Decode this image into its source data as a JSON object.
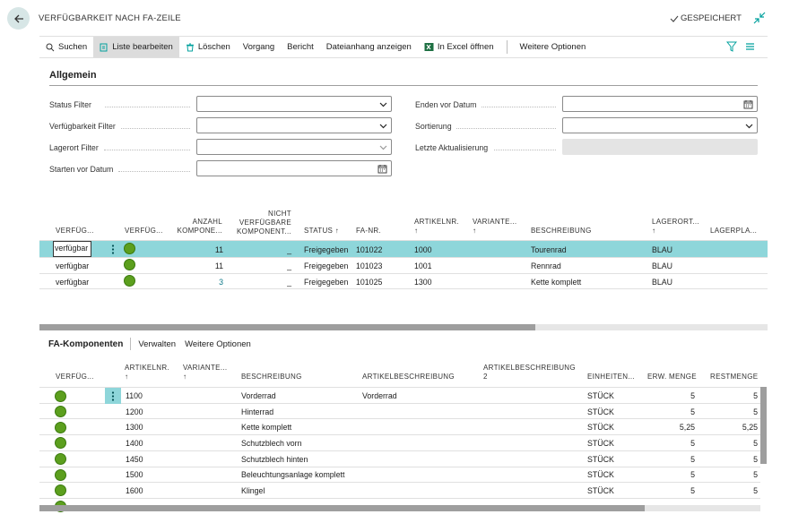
{
  "window": {
    "title": "VERFÜGBARKEIT NACH FA-ZEILE",
    "saved_label": "GESPEICHERT"
  },
  "actions": [
    {
      "label": "Suchen",
      "icon": "search-icon"
    },
    {
      "label": "Liste bearbeiten",
      "icon": "edit-list-icon"
    },
    {
      "label": "Löschen",
      "icon": "trash-icon"
    },
    {
      "label": "Vorgang",
      "icon": ""
    },
    {
      "label": "Bericht",
      "icon": ""
    },
    {
      "label": "Dateianhang anzeigen",
      "icon": ""
    },
    {
      "label": "In Excel öffnen",
      "icon": "excel-icon"
    },
    {
      "label": "Weitere Optionen",
      "icon": ""
    }
  ],
  "general": {
    "title": "Allgemein",
    "status_filter": {
      "label": "Status Filter",
      "value": ""
    },
    "availability_filter": {
      "label": "Verfügbarkeit Filter",
      "value": ""
    },
    "location_filter": {
      "label": "Lagerort Filter",
      "value": ""
    },
    "start_before": {
      "label": "Starten vor Datum",
      "value": ""
    },
    "end_before": {
      "label": "Enden vor Datum",
      "value": ""
    },
    "sorting": {
      "label": "Sortierung",
      "value": ""
    },
    "last_update": {
      "label": "Letzte Aktualisierung",
      "value": ""
    }
  },
  "main_grid": {
    "headers": {
      "availability_text": "VERFÜG...",
      "availability_icon": "VERFÜG...",
      "count_1": "ANZAHL",
      "count_2": "KOMPONE...",
      "notavail_1": "NICHT",
      "notavail_2": "VERFÜGBARE",
      "notavail_3": "KOMPONENT...",
      "status": "STATUS ↑",
      "fa_no": "FA-NR.",
      "item_no_1": "ARTIKELNR.",
      "item_no_2": "↑",
      "variant_1": "VARIANTE...",
      "variant_2": "↑",
      "description": "BESCHREIBUNG",
      "location_1": "LAGERORT...",
      "location_2": "↑",
      "bin": "LAGERPLA..."
    },
    "rows": [
      {
        "availability": "verfügbar",
        "count": "11",
        "notavail": "_",
        "status": "Freigegeben",
        "fa_no": "101022",
        "item_no": "1000",
        "description": "Tourenrad",
        "location": "BLAU"
      },
      {
        "availability": "verfügbar",
        "count": "11",
        "notavail": "_",
        "status": "Freigegeben",
        "fa_no": "101023",
        "item_no": "1001",
        "description": "Rennrad",
        "location": "BLAU"
      },
      {
        "availability": "verfügbar",
        "count": "3",
        "notavail": "_",
        "status": "Freigegeben",
        "fa_no": "101025",
        "item_no": "1300",
        "description": "Kette komplett",
        "location": "BLAU"
      }
    ]
  },
  "components": {
    "title": "FA-Komponenten",
    "actions": [
      "Verwalten",
      "Weitere Optionen"
    ],
    "headers": {
      "availability": "VERFÜG...",
      "item_no_1": "ARTIKELNR.",
      "item_no_2": "↑",
      "variant_1": "VARIANTE...",
      "variant_2": "↑",
      "description": "BESCHREIBUNG",
      "item_desc": "ARTIKELBESCHREIBUNG",
      "item_desc2_1": "ARTIKELBESCHREIBUNG",
      "item_desc2_2": "2",
      "unit": "EINHEITEN...",
      "expected": "ERW. MENGE",
      "remaining": "RESTMENGE"
    },
    "rows": [
      {
        "item_no": "1100",
        "description": "Vorderrad",
        "item_desc": "Vorderrad",
        "unit": "STÜCK",
        "expected": "5",
        "remaining": "5"
      },
      {
        "item_no": "1200",
        "description": "Hinterrad",
        "item_desc": "",
        "unit": "STÜCK",
        "expected": "5",
        "remaining": "5"
      },
      {
        "item_no": "1300",
        "description": "Kette komplett",
        "item_desc": "",
        "unit": "STÜCK",
        "expected": "5,25",
        "remaining": "5,25"
      },
      {
        "item_no": "1400",
        "description": "Schutzblech vorn",
        "item_desc": "",
        "unit": "STÜCK",
        "expected": "5",
        "remaining": "5"
      },
      {
        "item_no": "1450",
        "description": "Schutzblech hinten",
        "item_desc": "",
        "unit": "STÜCK",
        "expected": "5",
        "remaining": "5"
      },
      {
        "item_no": "1500",
        "description": "Beleuchtungsanlage komplett",
        "item_desc": "",
        "unit": "STÜCK",
        "expected": "5",
        "remaining": "5"
      },
      {
        "item_no": "1600",
        "description": "Klingel",
        "item_desc": "",
        "unit": "STÜCK",
        "expected": "5",
        "remaining": "5"
      }
    ]
  },
  "colors": {
    "selected_row": "#8ed6da",
    "available_green": "#5c9f1e",
    "back_button": "#d7e6e6",
    "accent": "#00a09d"
  }
}
